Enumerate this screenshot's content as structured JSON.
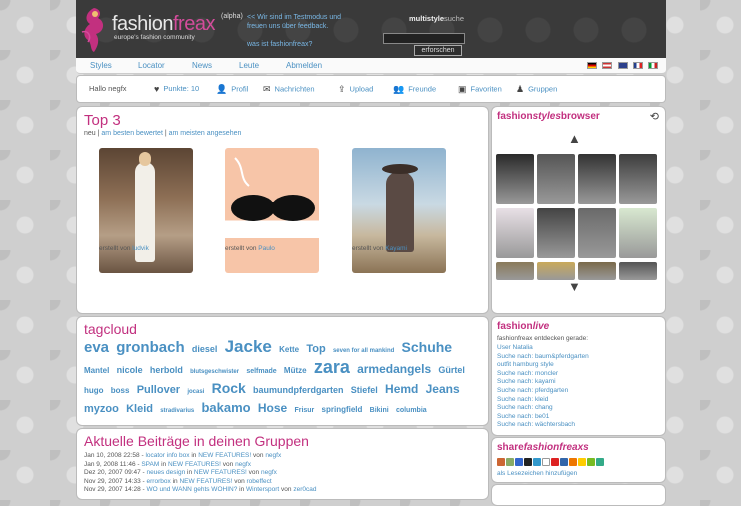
{
  "header": {
    "brand_main": "fashion",
    "brand_accent": "freax",
    "alpha": "(alpha)",
    "tagline": "europe's fashion community",
    "notice_1": "<< Wir sind im Testmodus und freuen uns über feedback.",
    "notice_2": "was ist fashionfreax?",
    "search_label_bold": "multistyle",
    "search_label_rest": "suche",
    "search_button": "erforschen"
  },
  "nav": {
    "items": [
      "Styles",
      "Locator",
      "News",
      "Leute",
      "Abmelden"
    ]
  },
  "userbar": {
    "hello": "Hallo negfx",
    "points": "Punkte: 10",
    "profile": "Profil",
    "messages": "Nachrichten",
    "upload": "Upload",
    "friends": "Freunde",
    "favorites": "Favoriten",
    "groups": "Gruppen"
  },
  "top3": {
    "title": "Top 3",
    "tab_new": "neu",
    "tab_best": "am besten bewertet",
    "tab_viewed": "am meisten angesehen",
    "items": [
      {
        "by": "erstellt von",
        "user": "ludvik"
      },
      {
        "by": "erstellt von",
        "user": "Paulo"
      },
      {
        "by": "erstellt von",
        "user": "Kayami"
      }
    ]
  },
  "tagcloud": {
    "title": "tagcloud",
    "tags": [
      "eva",
      "gronbach",
      "diesel",
      "Jacke",
      "Kette",
      "Top",
      "seven for all mankind",
      "Schuhe",
      "Mantel",
      "nicole",
      "herbold",
      "blutsgeschwister",
      "selfmade",
      "Mütze",
      "zara",
      "armedangels",
      "Gürtel",
      "hugo",
      "boss",
      "Pullover",
      "jocasi",
      "Rock",
      "baumundpferdgarten",
      "Stiefel",
      "Hemd",
      "Jeans",
      "myzoo",
      "Kleid",
      "stradivarius",
      "bakamo",
      "Hose",
      "Frisur",
      "springfield",
      "Bikini",
      "columbia"
    ],
    "sizes": [
      15,
      15,
      9,
      17,
      8,
      11,
      6,
      14,
      8,
      9,
      9,
      6,
      7,
      8,
      18,
      12,
      9,
      8,
      8,
      11,
      6,
      14,
      9,
      9,
      12,
      12,
      11,
      11,
      6,
      13,
      12,
      7,
      8,
      7,
      7
    ]
  },
  "groups": {
    "title": "Aktuelle Beiträge in deinen Gruppen",
    "posts": [
      {
        "date": "Jan 10, 2008 22:58",
        "a": "locator info box",
        "in": "in",
        "b": "NEW FEATURES!",
        "von": "von",
        "user": "negfx"
      },
      {
        "date": "Jan 9, 2008 11:46",
        "a": "SPAM",
        "in": "in",
        "b": "NEW FEATURES!",
        "von": "von",
        "user": "negfx"
      },
      {
        "date": "Dez 20, 2007 09:47",
        "a": "neues design",
        "in": "in",
        "b": "NEW FEATURES!",
        "von": "von",
        "user": "negfx"
      },
      {
        "date": "Nov 29, 2007 14:33",
        "a": "errorbox",
        "in": "in",
        "b": "NEW FEATURES!",
        "von": "von",
        "user": "robeffect"
      },
      {
        "date": "Nov 29, 2007 14:28",
        "a": "WO und WANN gehts WOHIN?",
        "in": "in",
        "b": "Wintersport",
        "von": "von",
        "user": "zer0cad"
      }
    ]
  },
  "browser": {
    "title_a": "fashion",
    "title_b": "styles",
    "title_c": "browser"
  },
  "live": {
    "title_a": "fashion",
    "title_b": "live",
    "subtitle": "fashionfreax entdecken gerade:",
    "items": [
      "User Natalia",
      "Suche nach: baum&pferdgarten",
      "outfit hamburg style",
      "Suche nach: moncler",
      "Suche nach: kayami",
      "Suche nach: pferdgarten",
      "Suche nach: kleid",
      "Suche nach: chang",
      "Suche nach: be01",
      "Suche nach: wächtersbach"
    ]
  },
  "share": {
    "title_a": "share",
    "title_b": "fashionfreaxs",
    "bookmark": "als Lesezeichen hinzufügen"
  },
  "colors": {
    "accent_pink": "#c2307f",
    "link_blue": "#4a90c2",
    "header_dark": "#3a3a3a"
  }
}
